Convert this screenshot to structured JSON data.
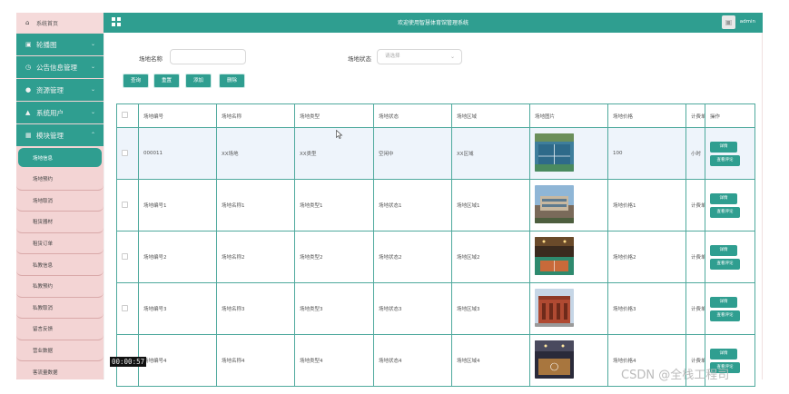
{
  "sidebar": {
    "home": "系统首页",
    "menus": [
      {
        "label": "轮播图",
        "icon": "image-icon"
      },
      {
        "label": "公告信息管理",
        "icon": "clock-icon"
      },
      {
        "label": "资源管理",
        "icon": "location-icon"
      },
      {
        "label": "系统用户",
        "icon": "user-icon"
      },
      {
        "label": "模块管理",
        "icon": "grid-icon"
      }
    ],
    "subitems": [
      "场地信息",
      "场地预约",
      "场地取消",
      "租赁器材",
      "租赁订单",
      "私教信息",
      "私教预约",
      "私教取消",
      "留言反馈",
      "营业数据",
      "客流量数据"
    ]
  },
  "topbar": {
    "title": "欢迎使用智慧体育馆管理系统",
    "user": "admin"
  },
  "search": {
    "name_label": "场地名称",
    "name_value": "",
    "status_label": "场地状态",
    "status_placeholder": "请选择"
  },
  "buttons": {
    "query": "查询",
    "reset": "重置",
    "add": "添加",
    "delete": "删除"
  },
  "table": {
    "headers": [
      "场地编号",
      "场地名称",
      "场地类型",
      "场地状态",
      "场地区域",
      "场地图片",
      "场地价格",
      "计费单",
      "操作"
    ],
    "rows": [
      {
        "code": "000011",
        "name": "XX场地",
        "type": "XX类型",
        "status": "空闲中",
        "area": "XX区域",
        "price": "100",
        "unit": "小时",
        "image": "tennis-court-photo"
      },
      {
        "code": "场地编号1",
        "name": "场地名称1",
        "type": "场地类型1",
        "status": "场地状态1",
        "area": "场地区域1",
        "price": "场地价格1",
        "unit": "计费单",
        "image": "stadium-exterior-photo"
      },
      {
        "code": "场地编号2",
        "name": "场地名称2",
        "type": "场地类型2",
        "status": "场地状态2",
        "area": "场地区域2",
        "price": "场地价格2",
        "unit": "计费单",
        "image": "indoor-court-photo"
      },
      {
        "code": "场地编号3",
        "name": "场地名称3",
        "type": "场地类型3",
        "status": "场地状态3",
        "area": "场地区域3",
        "price": "场地价格3",
        "unit": "计费单",
        "image": "brick-building-photo"
      },
      {
        "code": "场地编号4",
        "name": "场地名称4",
        "type": "场地类型4",
        "status": "场地状态4",
        "area": "场地区域4",
        "price": "场地价格4",
        "unit": "计费单",
        "image": "gym-interior-photo"
      }
    ],
    "action_detail": "详情",
    "action_review": "查看评论"
  },
  "overlay": {
    "timestamp": "00:00:57",
    "watermark": "CSDN @全栈工程司"
  },
  "colors": {
    "accent": "#2f9e90",
    "sidebar_bg": "#f3d4d4",
    "row_highlight": "#eef4fb"
  }
}
